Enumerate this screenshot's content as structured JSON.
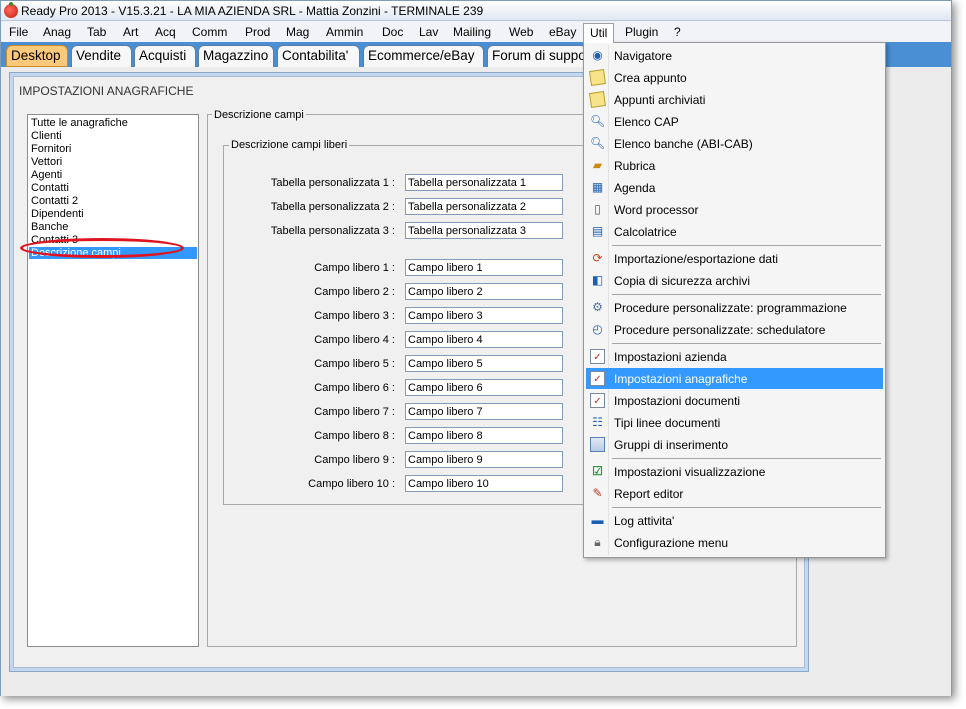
{
  "window": {
    "title": "Ready Pro 2013 - V15.3.21 - LA MIA AZIENDA SRL - Mattia Zonzini - TERMINALE 239"
  },
  "menubar": [
    "File",
    "Anag",
    "Tab",
    "Art",
    "Acq",
    "Comm",
    "Prod",
    "Mag",
    "Ammin",
    "Doc",
    "Lav",
    "Mailing",
    "Web",
    "eBay",
    "Util",
    "Plugin",
    "?"
  ],
  "tabs": [
    "Desktop",
    "Vendite",
    "Acquisti",
    "Magazzino",
    "Contabilita'",
    "Ecommerce/eBay",
    "Forum di supporto"
  ],
  "panel": {
    "title": "IMPOSTAZIONI ANAGRAFICHE",
    "list": [
      "Tutte le anagrafiche",
      "Clienti",
      "Fornitori",
      "Vettori",
      "Agenti",
      "Contatti",
      "Contatti 2",
      "Dipendenti",
      "Banche",
      "Contatti 3",
      "Descrizione campi"
    ],
    "selected_index": 10,
    "section_title": "Descrizione campi",
    "group_title": "Descrizione campi liberi",
    "tabelle": [
      {
        "label": "Tabella personalizzata 1 :",
        "value": "Tabella personalizzata 1"
      },
      {
        "label": "Tabella personalizzata 2 :",
        "value": "Tabella personalizzata 2"
      },
      {
        "label": "Tabella personalizzata 3 :",
        "value": "Tabella personalizzata 3"
      }
    ],
    "campi": [
      {
        "label": "Campo libero 1 :",
        "value": "Campo libero 1"
      },
      {
        "label": "Campo libero 2 :",
        "value": "Campo libero 2"
      },
      {
        "label": "Campo libero 3 :",
        "value": "Campo libero 3"
      },
      {
        "label": "Campo libero 4 :",
        "value": "Campo libero 4"
      },
      {
        "label": "Campo libero 5 :",
        "value": "Campo libero 5"
      },
      {
        "label": "Campo libero 6 :",
        "value": "Campo libero 6"
      },
      {
        "label": "Campo libero 7 :",
        "value": "Campo libero 7"
      },
      {
        "label": "Campo libero 8 :",
        "value": "Campo libero 8"
      },
      {
        "label": "Campo libero 9 :",
        "value": "Campo libero 9"
      },
      {
        "label": "Campo libero 10 :",
        "value": "Campo libero 10"
      }
    ]
  },
  "util_menu": [
    {
      "label": "Navigatore",
      "icon": "navigator-icon"
    },
    {
      "label": "Crea appunto",
      "icon": "note-icon"
    },
    {
      "label": "Appunti archiviati",
      "icon": "note-icon"
    },
    {
      "label": "Elenco CAP",
      "icon": "magnifier-icon"
    },
    {
      "label": "Elenco banche (ABI-CAB)",
      "icon": "magnifier-icon"
    },
    {
      "label": "Rubrica",
      "icon": "address-book-icon"
    },
    {
      "label": "Agenda",
      "icon": "agenda-icon"
    },
    {
      "label": "Word processor",
      "icon": "document-icon"
    },
    {
      "label": "Calcolatrice",
      "icon": "calculator-icon"
    },
    {
      "label": "Importazione/esportazione dati",
      "icon": "import-export-icon"
    },
    {
      "label": "Copia di sicurezza archivi",
      "icon": "backup-icon"
    },
    {
      "label": "Procedure personalizzate: programmazione",
      "icon": "gear-icon"
    },
    {
      "label": "Procedure personalizzate: schedulatore",
      "icon": "clock-icon"
    },
    {
      "label": "Impostazioni azienda",
      "icon": "checklist-icon"
    },
    {
      "label": "Impostazioni anagrafiche",
      "icon": "checklist-icon"
    },
    {
      "label": "Impostazioni documenti",
      "icon": "checklist-icon"
    },
    {
      "label": "Tipi linee documenti",
      "icon": "tree-icon"
    },
    {
      "label": "Gruppi di inserimento",
      "icon": "grid-icon"
    },
    {
      "label": "Impostazioni visualizzazione",
      "icon": "checkmark-icon"
    },
    {
      "label": "Report editor",
      "icon": "report-icon"
    },
    {
      "label": "Log attivita'",
      "icon": "log-icon"
    },
    {
      "label": "Configurazione menu",
      "icon": "lock-icon"
    }
  ],
  "util_highlighted_index": 14
}
